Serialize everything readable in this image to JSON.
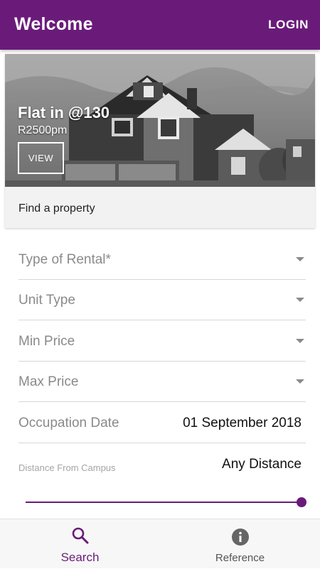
{
  "app_bar": {
    "title": "Welcome",
    "login_label": "LOGIN",
    "background": "#6a1b7a"
  },
  "featured": {
    "title": "Flat in @130",
    "price": "R2500pm",
    "view_label": "VIEW",
    "image_icon": "house-photo"
  },
  "find_property": "Find a property",
  "filters": {
    "rental_type": {
      "placeholder": "Type of Rental*",
      "icon": "dropdown-arrow-icon"
    },
    "unit_type": {
      "placeholder": "Unit Type",
      "icon": "dropdown-arrow-icon"
    },
    "min_price": {
      "placeholder": "Min Price",
      "icon": "dropdown-arrow-icon"
    },
    "max_price": {
      "placeholder": "Max Price",
      "icon": "dropdown-arrow-icon"
    },
    "occupation_date": {
      "label": "Occupation Date",
      "value": "01 September 2018"
    },
    "distance": {
      "label": "Distance From Campus",
      "value": "Any Distance",
      "slider_level": 1.0
    }
  },
  "bottom_nav": {
    "items": [
      {
        "label": "Search",
        "icon": "search-icon",
        "active": true
      },
      {
        "label": "Reference",
        "icon": "info-icon",
        "active": false
      }
    ],
    "accent": "#6a1b7a"
  }
}
